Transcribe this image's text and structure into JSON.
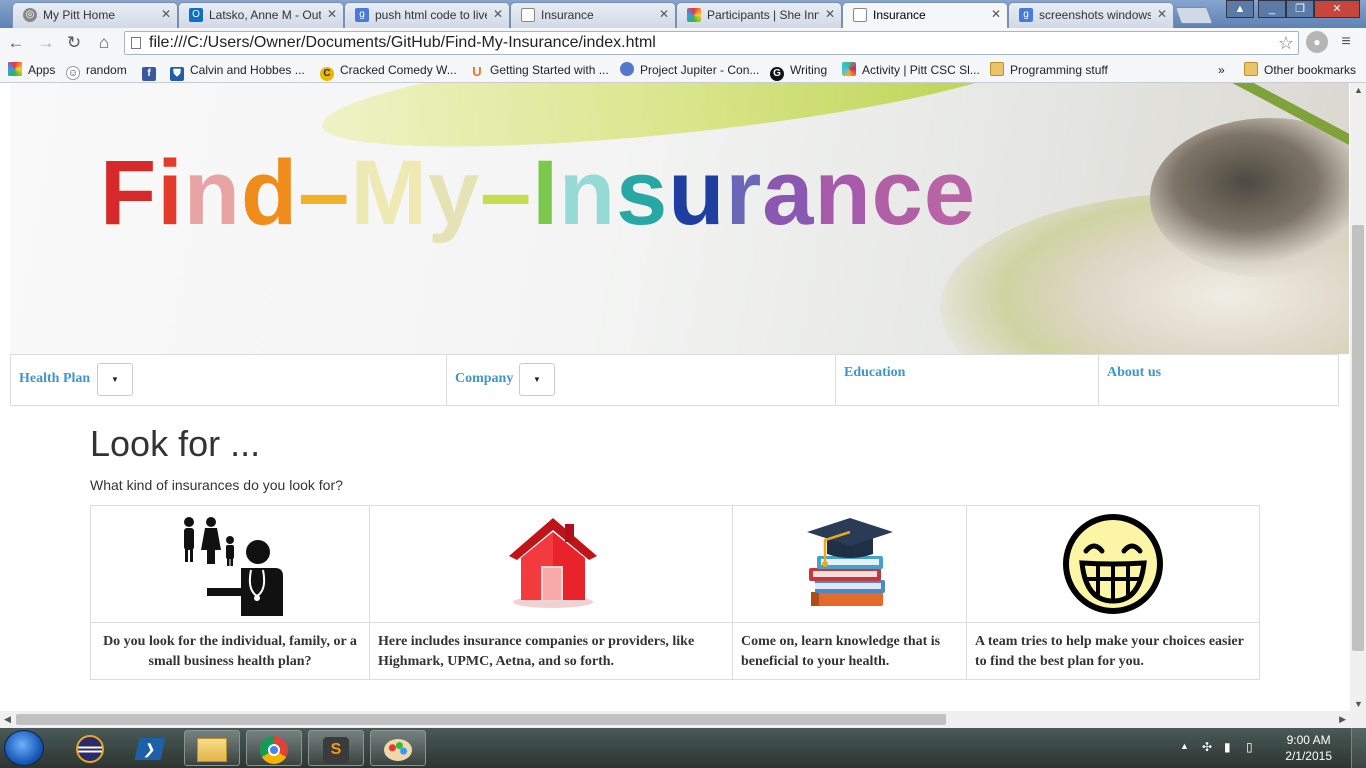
{
  "browser": {
    "tabs": [
      {
        "label": "My Pitt Home",
        "icon": "pitt-icon",
        "active": false
      },
      {
        "label": "Latsko, Anne M - Outlook",
        "icon": "outlook-icon",
        "active": false
      },
      {
        "label": "push html code to live",
        "icon": "google-icon",
        "active": false
      },
      {
        "label": "Insurance",
        "icon": "page-icon",
        "active": false
      },
      {
        "label": "Participants | She Innovates",
        "icon": "pinwheel-icon",
        "active": false
      },
      {
        "label": "Insurance",
        "icon": "page-icon",
        "active": true
      },
      {
        "label": "screenshots windows",
        "icon": "google-icon",
        "active": false
      }
    ],
    "url": "file:///C:/Users/Owner/Documents/GitHub/Find-My-Insurance/index.html",
    "bookmarks": [
      {
        "label": "Apps",
        "icon": "apps-grid-icon"
      },
      {
        "label": "random",
        "icon": "reddit-icon"
      },
      {
        "label": "",
        "icon": "facebook-icon"
      },
      {
        "label": "Calvin and Hobbes ...",
        "icon": "shield-icon"
      },
      {
        "label": "Cracked Comedy W...",
        "icon": "cracked-icon"
      },
      {
        "label": "Getting Started with ...",
        "icon": "udacity-icon"
      },
      {
        "label": "Project Jupiter - Con...",
        "icon": "circle-icon"
      },
      {
        "label": "Writing",
        "icon": "grammarly-icon"
      },
      {
        "label": "Activity | Pitt CSC Sl...",
        "icon": "slack-icon"
      },
      {
        "label": "Programming stuff",
        "icon": "folder-icon"
      },
      {
        "label": "Other bookmarks",
        "icon": "folder-icon"
      }
    ],
    "bookmarks_overflow": "»"
  },
  "page": {
    "banner_title": [
      "F",
      "i",
      "n",
      "d",
      "–",
      "M",
      "y",
      "–",
      "I",
      "n",
      "s",
      "u",
      "r",
      "a",
      "n",
      "c",
      "e"
    ],
    "banner_colors": [
      "#d62a2a",
      "#e23b2b",
      "#e8a4a4",
      "#f08c19",
      "#f2b227",
      "#efe9b4",
      "#e5e3b6",
      "#c6dd4e",
      "#7ac94a",
      "#96dad6",
      "#29a7a4",
      "#1f3fa0",
      "#6b67b8",
      "#8a58b0",
      "#a85aaa",
      "#b260a5",
      "#b764a6"
    ],
    "nav": [
      {
        "label": "Health Plan",
        "dropdown": true
      },
      {
        "label": "Company",
        "dropdown": true
      },
      {
        "label": "Education",
        "dropdown": false
      },
      {
        "label": "About us",
        "dropdown": false
      }
    ],
    "dropdown_caret": "▼",
    "heading": "Look for ...",
    "subheading": "What kind of insurances do you look for?",
    "cards": [
      {
        "image": "family-doctor-icon",
        "text": "Do you look for the individual, family, or a small business health plan?"
      },
      {
        "image": "red-house-icon",
        "text": "Here includes insurance companies or providers, like Highmark, UPMC, Aetna, and so forth."
      },
      {
        "image": "graduation-books-icon",
        "text": "Come on, learn knowledge that is beneficial to your health."
      },
      {
        "image": "grinning-face-icon",
        "text": "A team tries to help make your choices easier to find the best plan for you."
      }
    ],
    "link_color": "#3f96c9"
  },
  "taskbar": {
    "apps": [
      "eclipse-icon",
      "powershell-icon",
      "file-explorer-icon",
      "chrome-icon",
      "sublime-text-icon",
      "paint-icon"
    ],
    "time": "9:00 AM",
    "date": "2/1/2015"
  }
}
